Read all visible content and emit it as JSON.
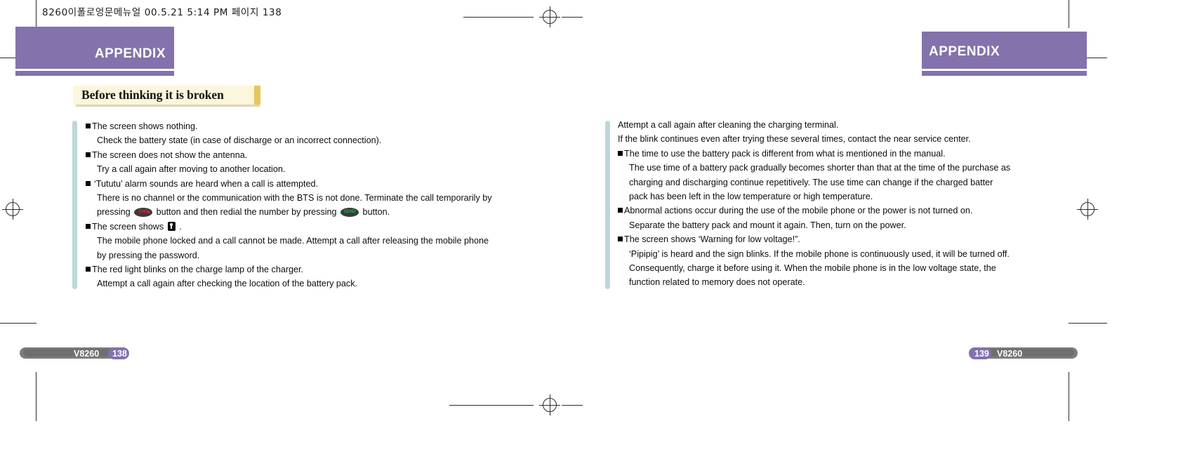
{
  "document": {
    "running_head": "8260이폴로엉문메뉴얼   00.5.21 5:14 PM  페이지 138",
    "colors": {
      "banner_purple": "#8372ac",
      "plate_cream": "#fbf6dc",
      "plate_gold": "#e8c65a",
      "col_bar_blue": "#bdd6d9",
      "footer_gray": "#7d7d7d",
      "end_key_red": "#e0202c",
      "send_key_green": "#16b04a"
    }
  },
  "left_page": {
    "banner_title": "APPENDIX",
    "section_title": "Before thinking it is broken",
    "lines": [
      {
        "bullet": true,
        "indent": false,
        "text": "The screen shows nothing."
      },
      {
        "bullet": false,
        "indent": true,
        "text": "Check the battery state (in case of discharge or an incorrect connection)."
      },
      {
        "bullet": true,
        "indent": false,
        "text": "The screen does not show the antenna."
      },
      {
        "bullet": false,
        "indent": true,
        "text": "Try a call again after moving to another location."
      },
      {
        "bullet": true,
        "indent": false,
        "spaced": true,
        "text": "‘Tututu’ alarm sounds are heard when a call is attempted."
      },
      {
        "bullet": false,
        "indent": true,
        "text": "There is no channel or the communication with the BTS is not done. Terminate the call temporarily by"
      },
      {
        "bullet": false,
        "indent": true,
        "keys": "end_send",
        "pre": " pressing ",
        "mid": " button and then redial the number by pressing ",
        "post": " button."
      },
      {
        "bullet": true,
        "indent": false,
        "lock": true,
        "pre": "The screen shows ",
        "post": " ."
      },
      {
        "bullet": false,
        "indent": true,
        "text": "The mobile phone locked and a call cannot  be made. Attempt a call after releasing  the mobile phone"
      },
      {
        "bullet": false,
        "indent": true,
        "text": "by pressing the password."
      },
      {
        "bullet": true,
        "indent": false,
        "text": "The red light blinks on the charge lamp of the charger."
      },
      {
        "bullet": false,
        "indent": true,
        "text": "Attempt a call again after checking the location of the battery pack."
      }
    ],
    "footer": {
      "model": "V8260",
      "page": "138"
    }
  },
  "right_page": {
    "banner_title": "APPENDIX",
    "lines": [
      {
        "bullet": false,
        "indent": false,
        "text": "Attempt a call again after cleaning the charging terminal."
      },
      {
        "bullet": false,
        "indent": false,
        "text": "If the blink  continues even after  trying these several  times, contact the  near service center."
      },
      {
        "bullet": true,
        "indent": false,
        "text": "The time to use the battery pack is different from what is mentioned in the manual."
      },
      {
        "bullet": false,
        "indent": true,
        "text": "The use time of a battery pack gradually becomes  shorter than that at the time of the purchase as"
      },
      {
        "bullet": false,
        "indent": true,
        "text": "charging and discharging continue repetitively. The use time  can change if the charged batter"
      },
      {
        "bullet": false,
        "indent": true,
        "text": "pack has been left in the low temperature or high temperature."
      },
      {
        "bullet": true,
        "indent": false,
        "text": "Abnormal actions occur during  the use of the mobile  phone or  the power  is not turned on."
      },
      {
        "bullet": false,
        "indent": true,
        "text": "Separate the battery pack and mount it again. Then, turn on the power."
      },
      {
        "bullet": true,
        "indent": false,
        "text": "The screen shows  ‘Warning for low voltage!”."
      },
      {
        "bullet": false,
        "indent": true,
        "text": "‘Pipipig’  is heard and the sign blinks. If the mobile phone is continuously used, it will be turned off."
      },
      {
        "bullet": false,
        "indent": true,
        "text": "Consequently, charge it before using  it. When the mobile  phone is in the  low voltage state, the"
      },
      {
        "bullet": false,
        "indent": true,
        "text": "function related to memory does not operate."
      }
    ],
    "footer": {
      "model": "V8260",
      "page": "139"
    }
  }
}
